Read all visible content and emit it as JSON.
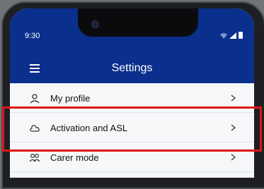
{
  "status_bar": {
    "time": "9:30"
  },
  "header": {
    "title": "Settings"
  },
  "settings_list": [
    {
      "label": "My profile",
      "icon": "person-icon"
    },
    {
      "label": "Activation and ASL",
      "icon": "cloud-icon"
    },
    {
      "label": "Carer mode",
      "icon": "people-icon"
    }
  ],
  "colors": {
    "header": "#0a2f8c",
    "highlight": "#e01616",
    "list_bg": "#f6f7f9"
  }
}
